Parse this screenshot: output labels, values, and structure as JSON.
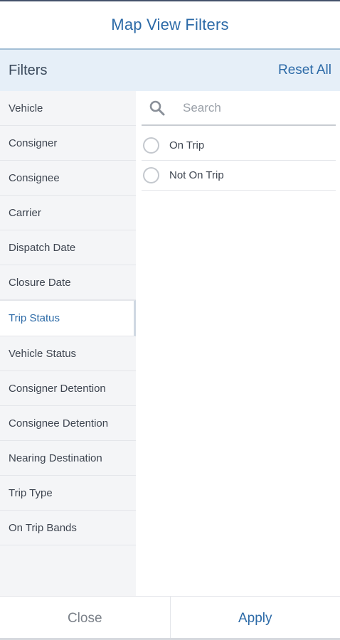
{
  "header": {
    "title": "Map View Filters"
  },
  "filters_bar": {
    "label": "Filters",
    "reset_label": "Reset All"
  },
  "sidebar": {
    "items": [
      {
        "label": "Vehicle"
      },
      {
        "label": "Consigner"
      },
      {
        "label": "Consignee"
      },
      {
        "label": "Carrier"
      },
      {
        "label": "Dispatch Date"
      },
      {
        "label": "Closure Date"
      },
      {
        "label": "Trip Status",
        "active": true
      },
      {
        "label": "Vehicle Status"
      },
      {
        "label": "Consigner Detention"
      },
      {
        "label": "Consignee Detention"
      },
      {
        "label": "Nearing Destination"
      },
      {
        "label": "Trip Type"
      },
      {
        "label": "On Trip Bands"
      }
    ]
  },
  "search": {
    "placeholder": "Search",
    "value": ""
  },
  "options": [
    {
      "label": "On Trip",
      "selected": false
    },
    {
      "label": "Not On Trip",
      "selected": false
    }
  ],
  "footer": {
    "close_label": "Close",
    "apply_label": "Apply"
  },
  "colors": {
    "accent": "#2c6aa7",
    "header_band": "#e6eff8",
    "sidebar_bg": "#f4f5f7"
  },
  "icons": {
    "search": "search-icon",
    "radio": "radio-icon"
  }
}
